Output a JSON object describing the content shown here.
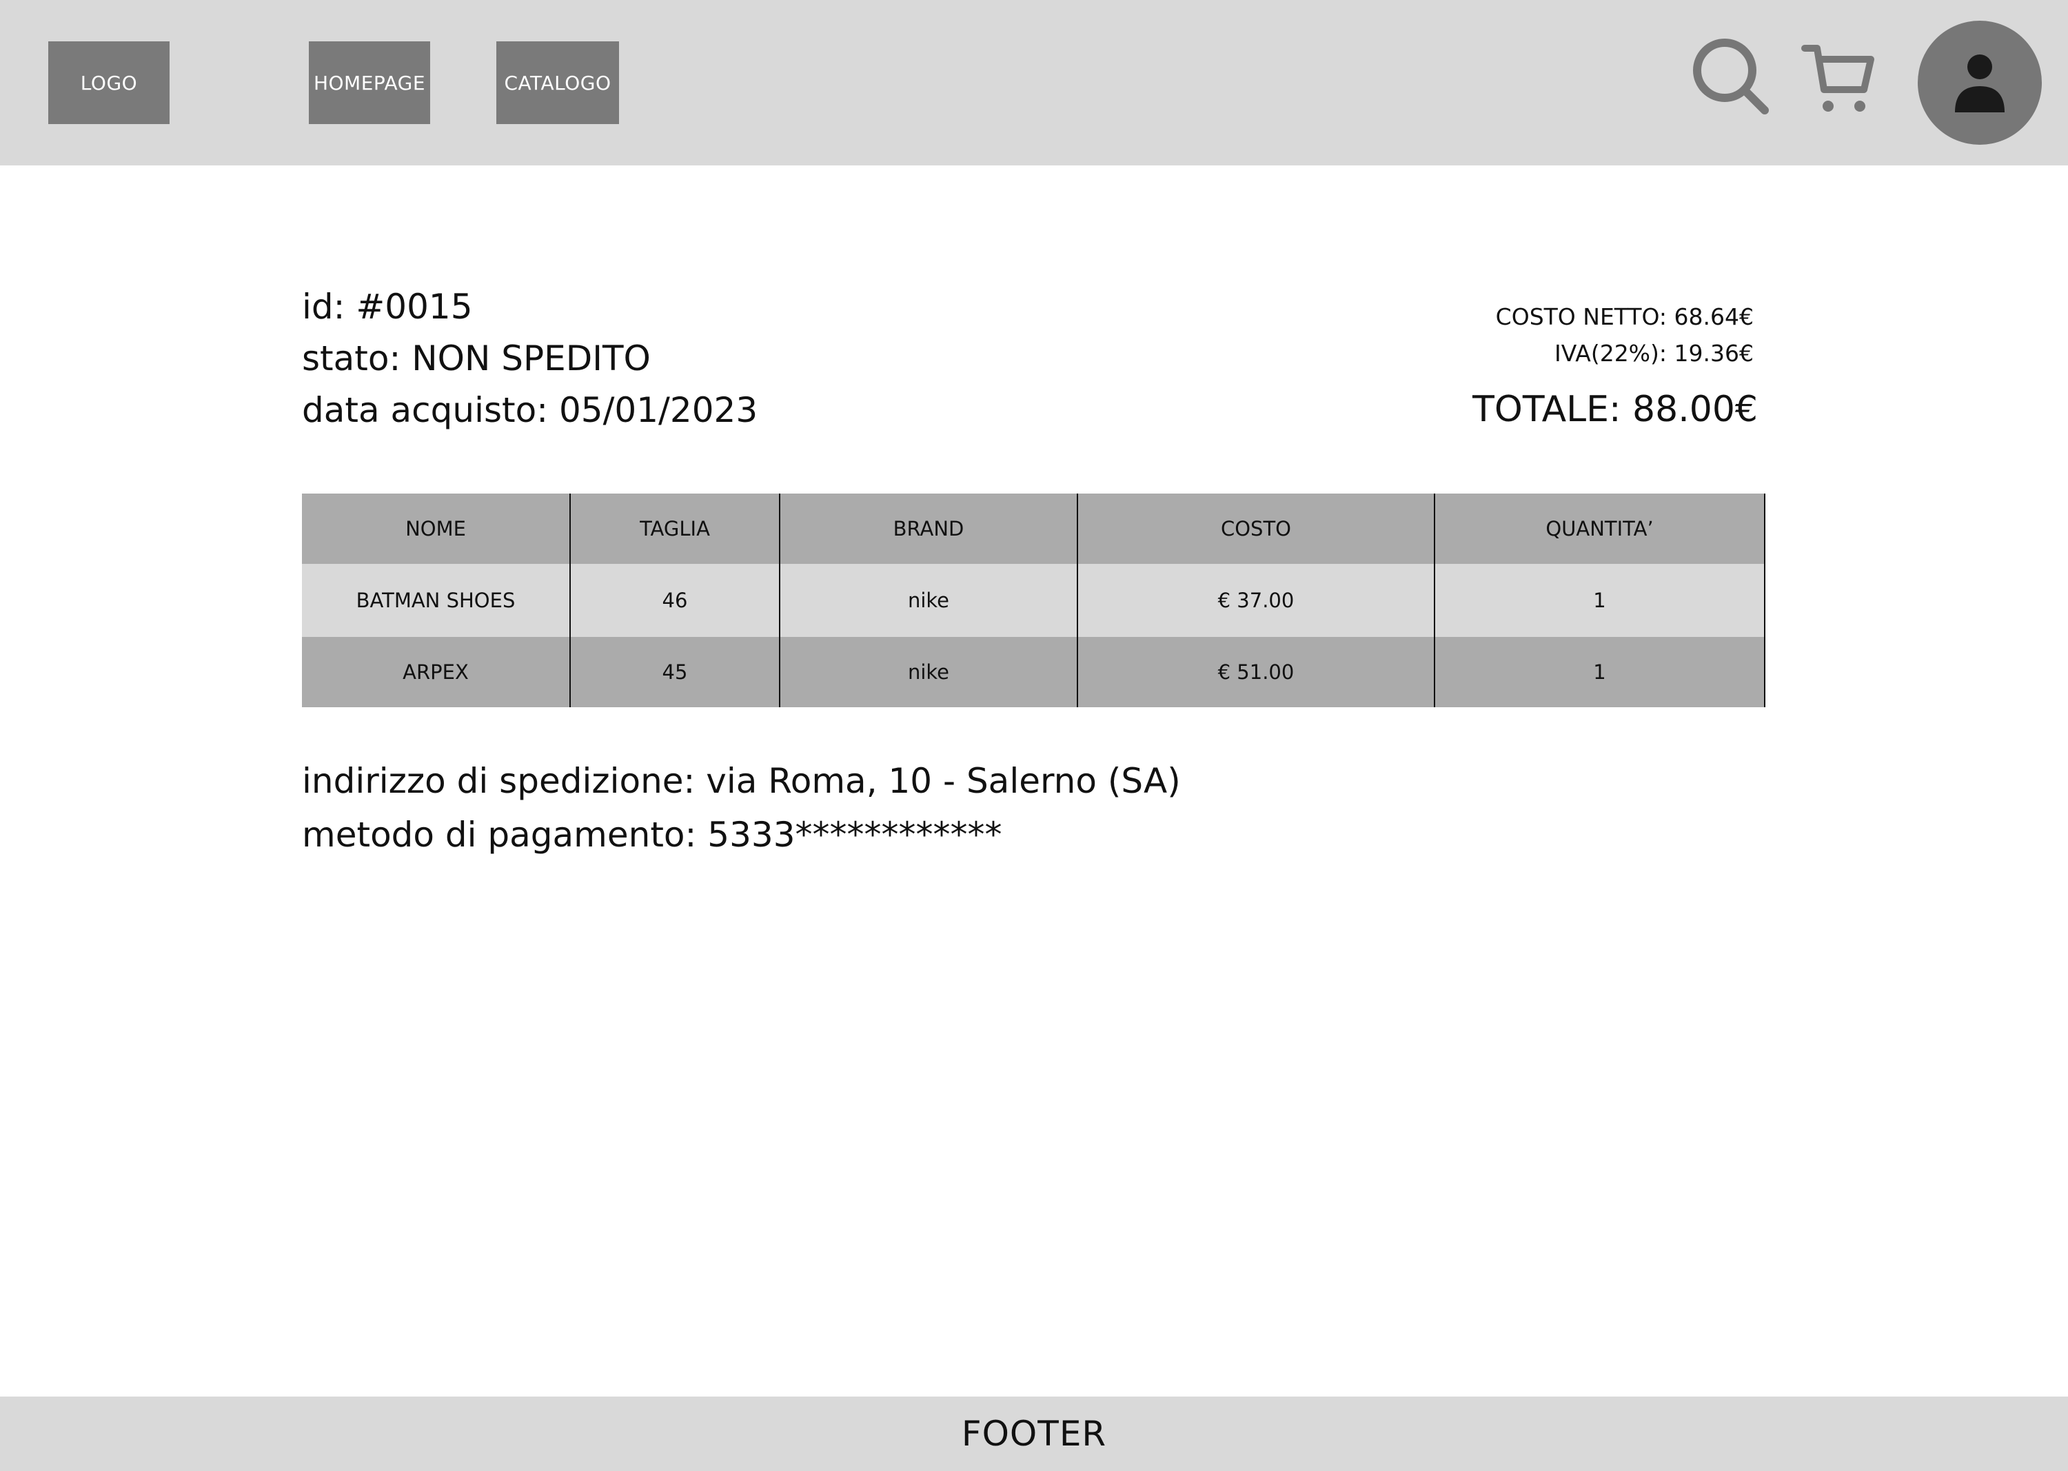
{
  "header": {
    "logo_label": "LOGO",
    "nav": {
      "homepage_label": "HOMEPAGE",
      "catalog_label": "CATALOGO"
    },
    "icons": {
      "search": "search-icon",
      "cart": "cart-icon",
      "avatar": "user-icon"
    }
  },
  "order": {
    "id_line": "id: #0015",
    "status_line": "stato: NON SPEDITO",
    "date_line": "data acquisto: 05/01/2023",
    "net_cost_line": "COSTO NETTO: 68.64€",
    "vat_line": "IVA(22%): 19.36€",
    "total_line": "TOTALE: 88.00€"
  },
  "table": {
    "columns": [
      "NOME",
      "TAGLIA",
      "BRAND",
      "COSTO",
      "QUANTITA’"
    ],
    "rows": [
      [
        "BATMAN SHOES",
        "46",
        "nike",
        "€ 37.00",
        "1"
      ],
      [
        "ARPEX",
        "45",
        "nike",
        "€ 51.00",
        "1"
      ]
    ]
  },
  "shipping": {
    "address_line": "indirizzo di spedizione: via Roma, 10 - Salerno (SA)",
    "payment_line": "metodo di pagamento: 5333************"
  },
  "footer": {
    "label": "FOOTER"
  },
  "colors": {
    "header_bg": "#d9d9d9",
    "button_bg": "#7a7a7a",
    "icon_gray": "#777777",
    "table_dark": "#ababab",
    "table_light": "#d9d9d9"
  }
}
